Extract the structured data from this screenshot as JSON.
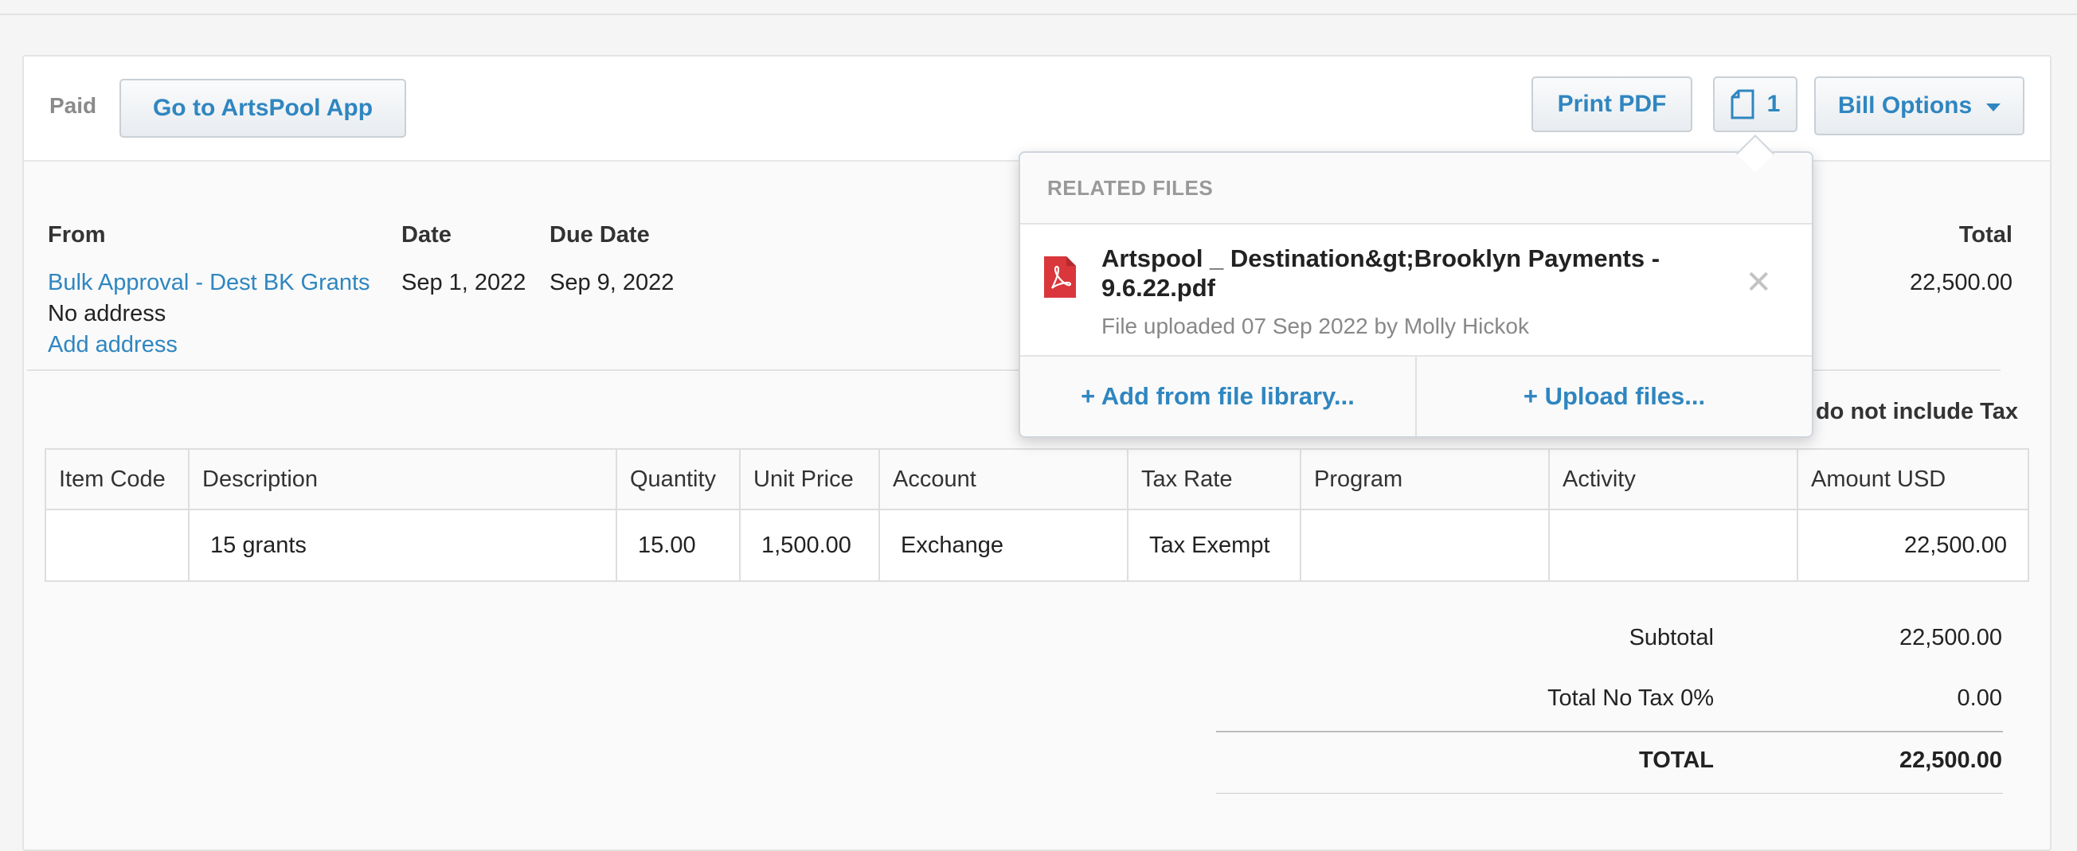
{
  "header": {
    "status": "Paid",
    "app_button": "Go to ArtsPool App",
    "print_button": "Print PDF",
    "files_count": "1",
    "options_button": "Bill Options"
  },
  "bill": {
    "from_label": "From",
    "from_value": "Bulk Approval - Dest BK Grants",
    "address": "No address",
    "add_address": "Add address",
    "date_label": "Date",
    "date_value": "Sep 1, 2022",
    "due_label": "Due Date",
    "due_value": "Sep 9, 2022",
    "total_label": "Total",
    "total_value": "22,500.00",
    "tax_note": "do not include Tax"
  },
  "table": {
    "headers": [
      "Item Code",
      "Description",
      "Quantity",
      "Unit Price",
      "Account",
      "Tax Rate",
      "Program",
      "Activity",
      "Amount USD"
    ],
    "rows": [
      [
        "",
        "15 grants",
        "15.00",
        "1,500.00",
        "Exchange",
        "Tax Exempt",
        "",
        "",
        "22,500.00"
      ]
    ]
  },
  "totals": {
    "subtotal_label": "Subtotal",
    "subtotal_value": "22,500.00",
    "tax_label": "Total No Tax 0%",
    "tax_value": "0.00",
    "total_label": "TOTAL",
    "total_value": "22,500.00"
  },
  "popup": {
    "title": "RELATED FILES",
    "file_name": "Artspool _ Destination&gt;Brooklyn Payments - 9.6.22.pdf",
    "file_meta": "File uploaded 07 Sep 2022 by Molly Hickok",
    "close": "✕",
    "add_library": "+ Add from file library...",
    "upload": "+ Upload files..."
  },
  "colors": {
    "accent": "#2f86c0",
    "pdf_red": "#d9373b"
  }
}
